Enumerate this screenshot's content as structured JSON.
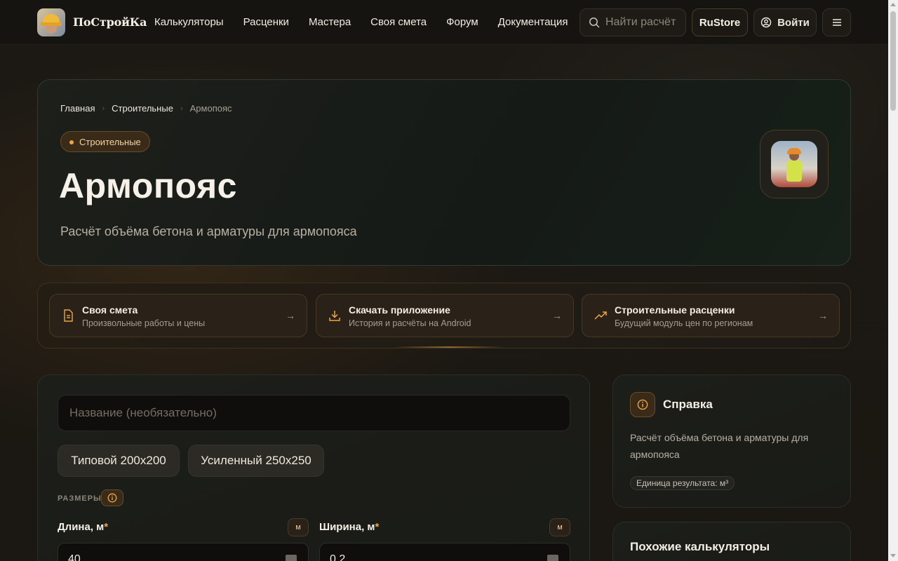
{
  "header": {
    "brand": "ПоСтройКа",
    "nav": [
      "Калькуляторы",
      "Расценки",
      "Мастера",
      "Своя смета",
      "Форум",
      "Документация"
    ],
    "search_placeholder": "Найти расчёт",
    "rustore_label": "RuStore",
    "login_label": "Войти"
  },
  "hero": {
    "breadcrumbs": [
      "Главная",
      "Строительные",
      "Армопояс"
    ],
    "category_chip": "Строительные",
    "title": "Армопояс",
    "subtitle": "Расчёт объёма бетона и арматуры для армопояса"
  },
  "quick_links": [
    {
      "title": "Своя смета",
      "desc": "Произвольные работы и цены",
      "icon": "document-icon"
    },
    {
      "title": "Скачать приложение",
      "desc": "История и расчёты на Android",
      "icon": "download-icon"
    },
    {
      "title": "Строительные расценки",
      "desc": "Будущий модуль цен по регионам",
      "icon": "trending-up-icon"
    }
  ],
  "calculator": {
    "name_placeholder": "Название (необязательно)",
    "presets": [
      "Типовой 200x200",
      "Усиленный 250x250"
    ],
    "section_label": "РАЗМЕРЫ",
    "fields": [
      {
        "label": "Длина, м",
        "required_mark": "*",
        "unit": "м",
        "value": "40"
      },
      {
        "label": "Ширина, м",
        "required_mark": "*",
        "unit": "м",
        "value": "0.2"
      }
    ]
  },
  "help": {
    "title": "Справка",
    "description": "Расчёт объёма бетона и арматуры для армопояса",
    "unit_badge": "Единица результата: м³"
  },
  "similar": {
    "title": "Похожие калькуляторы"
  },
  "colors": {
    "accent": "#f0a542",
    "background": "#1a1713",
    "text": "#ece7dd"
  }
}
